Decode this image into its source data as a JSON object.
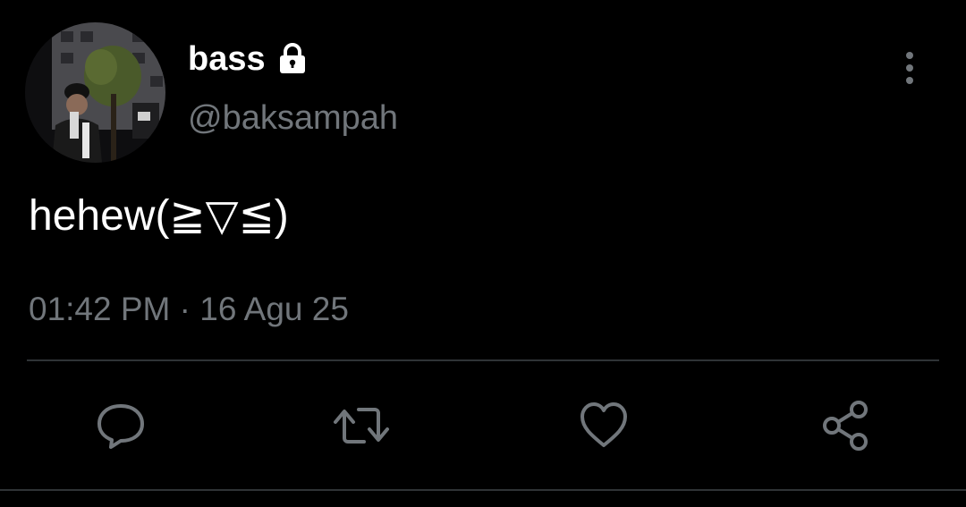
{
  "user": {
    "display_name": "bass",
    "handle": "@baksampah",
    "protected_icon": "lock-icon"
  },
  "tweet": {
    "text": "hehew(≧▽≦)",
    "timestamp": "01:42 PM · 16 Agu 25"
  },
  "actions": {
    "reply_icon": "comment-bubble-icon",
    "retweet_icon": "retweet-icon",
    "like_icon": "heart-icon",
    "share_icon": "share-icon",
    "more_icon": "vertical-dots-icon"
  },
  "colors": {
    "background": "#000000",
    "primary_text": "#ffffff",
    "secondary_text": "#71767b",
    "divider": "#2f3336"
  }
}
